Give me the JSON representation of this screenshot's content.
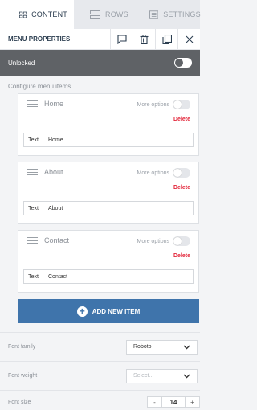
{
  "tabs": [
    {
      "label": "CONTENT",
      "icon": "content-grid-icon"
    },
    {
      "label": "ROWS",
      "icon": "rows-icon"
    },
    {
      "label": "SETTINGS",
      "icon": "settings-icon"
    }
  ],
  "toolbar": {
    "title": "MENU PROPERTIES"
  },
  "lock": {
    "label": "Unlocked"
  },
  "section": {
    "configure_label": "Configure menu items"
  },
  "items": [
    {
      "title": "Home",
      "more_label": "More options",
      "delete_label": "Delete",
      "text_label": "Text",
      "text_value": "Home"
    },
    {
      "title": "About",
      "more_label": "More options",
      "delete_label": "Delete",
      "text_label": "Text",
      "text_value": "About"
    },
    {
      "title": "Contact",
      "more_label": "More options",
      "delete_label": "Delete",
      "text_label": "Text",
      "text_value": "Contact"
    }
  ],
  "add_button": {
    "label": "ADD NEW ITEM"
  },
  "properties": {
    "font_family": {
      "label": "Font family",
      "value": "Roboto"
    },
    "font_weight": {
      "label": "Font weight",
      "placeholder": "Select..."
    },
    "font_size": {
      "label": "Font size",
      "minus": "-",
      "value": "14",
      "plus": "+"
    }
  },
  "colors": {
    "accent": "#3f74ab",
    "delete": "#e3263a",
    "lockbar": "#5f6266"
  }
}
